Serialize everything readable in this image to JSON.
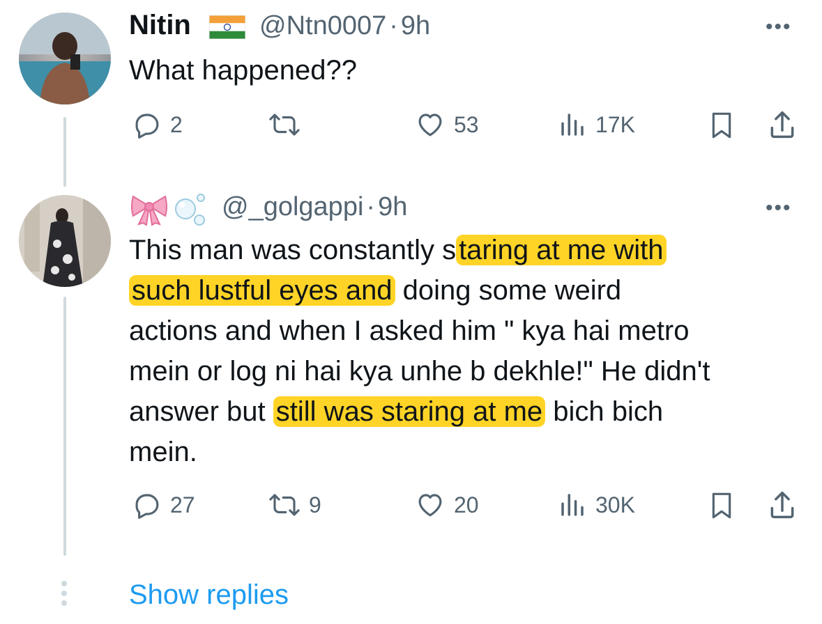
{
  "tweet1": {
    "name": "Nitin",
    "flag": "🇮🇳",
    "handle": "@Ntn0007",
    "sep": "·",
    "time": "9h",
    "more": "•••",
    "text": "What happened??",
    "actions": {
      "replies": "2",
      "retweets": "",
      "likes": "53",
      "views": "17K"
    }
  },
  "tweet2": {
    "emoji": "🎀🫧",
    "handle": "@_golgappi",
    "sep": "·",
    "time": "9h",
    "more": "•••",
    "text_parts": [
      "This man was constantly s",
      "taring at me with",
      "such lustful eyes and",
      " doing some weird",
      "actions and when I asked him \" kya hai metro",
      "mein or log ni hai kya unhe b dekhle!\" He didn't",
      "answer but",
      "still was staring at me",
      " bich bich",
      "mein."
    ],
    "actions": {
      "replies": "27",
      "retweets": "9",
      "likes": "20",
      "views": "30K"
    }
  },
  "show_replies": "Show replies",
  "colors": {
    "accent": "#1d9bf0",
    "muted": "#536471",
    "highlight": "#ffcc00",
    "thread": "#cfd9de"
  },
  "icons": [
    "reply-icon",
    "retweet-icon",
    "like-icon",
    "views-icon",
    "bookmark-icon",
    "share-icon",
    "more-icon"
  ]
}
